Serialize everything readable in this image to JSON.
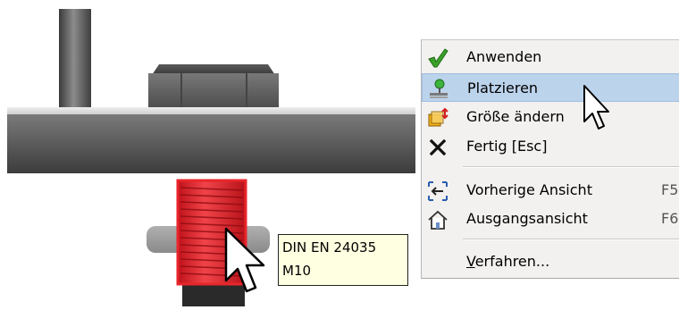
{
  "tooltip": {
    "line1": "DIN EN 24035",
    "line2": "M10"
  },
  "menu": {
    "items": [
      {
        "label": "Anwenden",
        "icon": "checkmark-icon"
      },
      {
        "label": "Platzieren",
        "icon": "place-icon"
      },
      {
        "label": "Größe ändern",
        "icon": "resize-icon"
      },
      {
        "label": "Fertig [Esc]",
        "icon": "close-icon"
      },
      {
        "label": "Vorherige Ansicht",
        "shortcut": "F5",
        "icon": "previous-view-icon"
      },
      {
        "label": "Ausgangsansicht",
        "shortcut": "F6",
        "icon": "home-view-icon"
      },
      {
        "label": "Verfahren...",
        "mnemonic": "V"
      }
    ]
  },
  "colors": {
    "highlight": "#bcd3ec",
    "selection": "#e8262b",
    "tooltip_bg": "#ffffe1",
    "menu_bg": "#f2f1ef"
  }
}
